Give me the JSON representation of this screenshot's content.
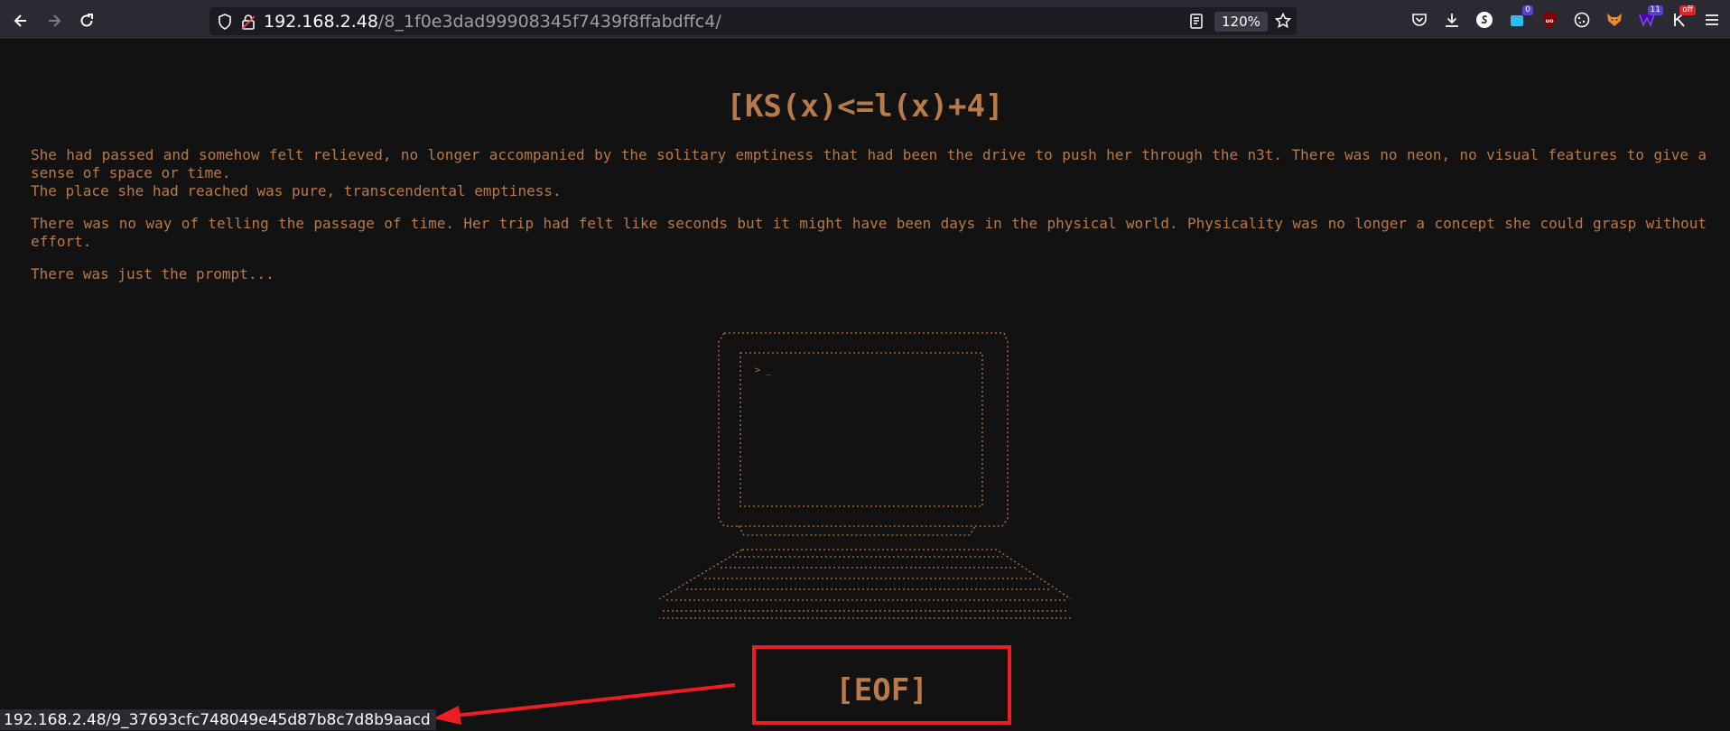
{
  "browser": {
    "url_host": "192.168.2.48",
    "url_path": "/8_1f0e3dad99908345f7439f8ffabdffc4/",
    "zoom": "120%",
    "pocket_badge": "0",
    "ext_badge_2": "11",
    "ext_badge_3": "off"
  },
  "page": {
    "title": "[KS(x)<=l(x)+4]",
    "paragraphs": [
      "She had passed and somehow felt relieved, no longer accompanied by the solitary emptiness that had been the drive to push her through the n3t. There was no neon, no visual features to give a sense of space or time.",
      "The place she had reached was pure, transcendental emptiness.",
      "There was no way of telling the passage of time. Her trip had felt like seconds but it might have been days in the physical world. Physicality was no longer a concept she could grasp without effort.",
      "There was just the prompt..."
    ],
    "prompt": "> _",
    "eof": "[EOF]"
  },
  "status_bar": {
    "link_url": "192.168.2.48/9_37693cfc748049e45d87b8c7d8b9aacd"
  },
  "colors": {
    "text": "#b77a4b",
    "background": "#121212",
    "highlight": "#ee1c24",
    "toolbar": "#2b2a33"
  }
}
